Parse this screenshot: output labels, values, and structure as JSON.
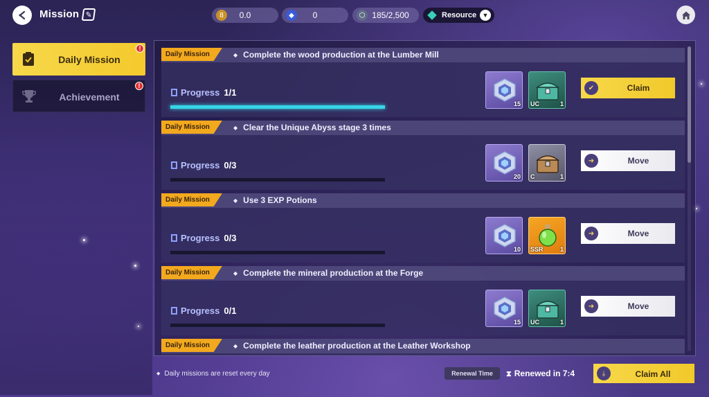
{
  "header": {
    "title": "Mission",
    "title_icon": "notebook-icon",
    "resources": [
      {
        "icon": "gold-coin-icon",
        "value": "0.0"
      },
      {
        "icon": "blue-crystal-icon",
        "value": "0"
      },
      {
        "icon": "gear-token-icon",
        "value": "185/2,500"
      }
    ],
    "resource_dropdown": {
      "label": "Resource"
    }
  },
  "sidebar": {
    "tabs": [
      {
        "label": "Daily Mission",
        "selected": true,
        "badge": "!"
      },
      {
        "label": "Achievement",
        "selected": false,
        "badge": "!"
      }
    ]
  },
  "missions": [
    {
      "tag": "Daily Mission",
      "name": "Complete the wood production at the Lumber Mill",
      "progress_label": "Progress",
      "progress_value": "1/1",
      "progress": 1.0,
      "rewards": [
        {
          "type": "gem-cube",
          "count": "15"
        },
        {
          "type": "chest",
          "rarity": "UC",
          "count": "1"
        }
      ],
      "action": "Claim"
    },
    {
      "tag": "Daily Mission",
      "name": "Clear the Unique Abyss stage 3 times",
      "progress_label": "Progress",
      "progress_value": "0/3",
      "progress": 0.0,
      "rewards": [
        {
          "type": "gem-cube",
          "count": "20"
        },
        {
          "type": "chest",
          "rarity": "C",
          "count": "1"
        }
      ],
      "action": "Move"
    },
    {
      "tag": "Daily Mission",
      "name": "Use 3 EXP Potions",
      "progress_label": "Progress",
      "progress_value": "0/3",
      "progress": 0.0,
      "rewards": [
        {
          "type": "gem-cube",
          "count": "10"
        },
        {
          "type": "potion",
          "rarity": "SSR",
          "count": "1"
        }
      ],
      "action": "Move"
    },
    {
      "tag": "Daily Mission",
      "name": "Complete the mineral production at the Forge",
      "progress_label": "Progress",
      "progress_value": "0/1",
      "progress": 0.0,
      "rewards": [
        {
          "type": "gem-cube",
          "count": "15"
        },
        {
          "type": "chest",
          "rarity": "UC",
          "count": "1"
        }
      ],
      "action": "Move"
    },
    {
      "tag": "Daily Mission",
      "name": "Complete the leather production at the Leather Workshop"
    }
  ],
  "footer": {
    "note": "Daily missions are reset every day",
    "renewal_label": "Renewal Time",
    "renewed_text": "Renewed in 7:4",
    "claim_all": "Claim All"
  },
  "colors": {
    "accent_yellow": "#f4c92c",
    "tag_orange": "#f3a91e",
    "progress_cyan": "#37d4e6"
  }
}
